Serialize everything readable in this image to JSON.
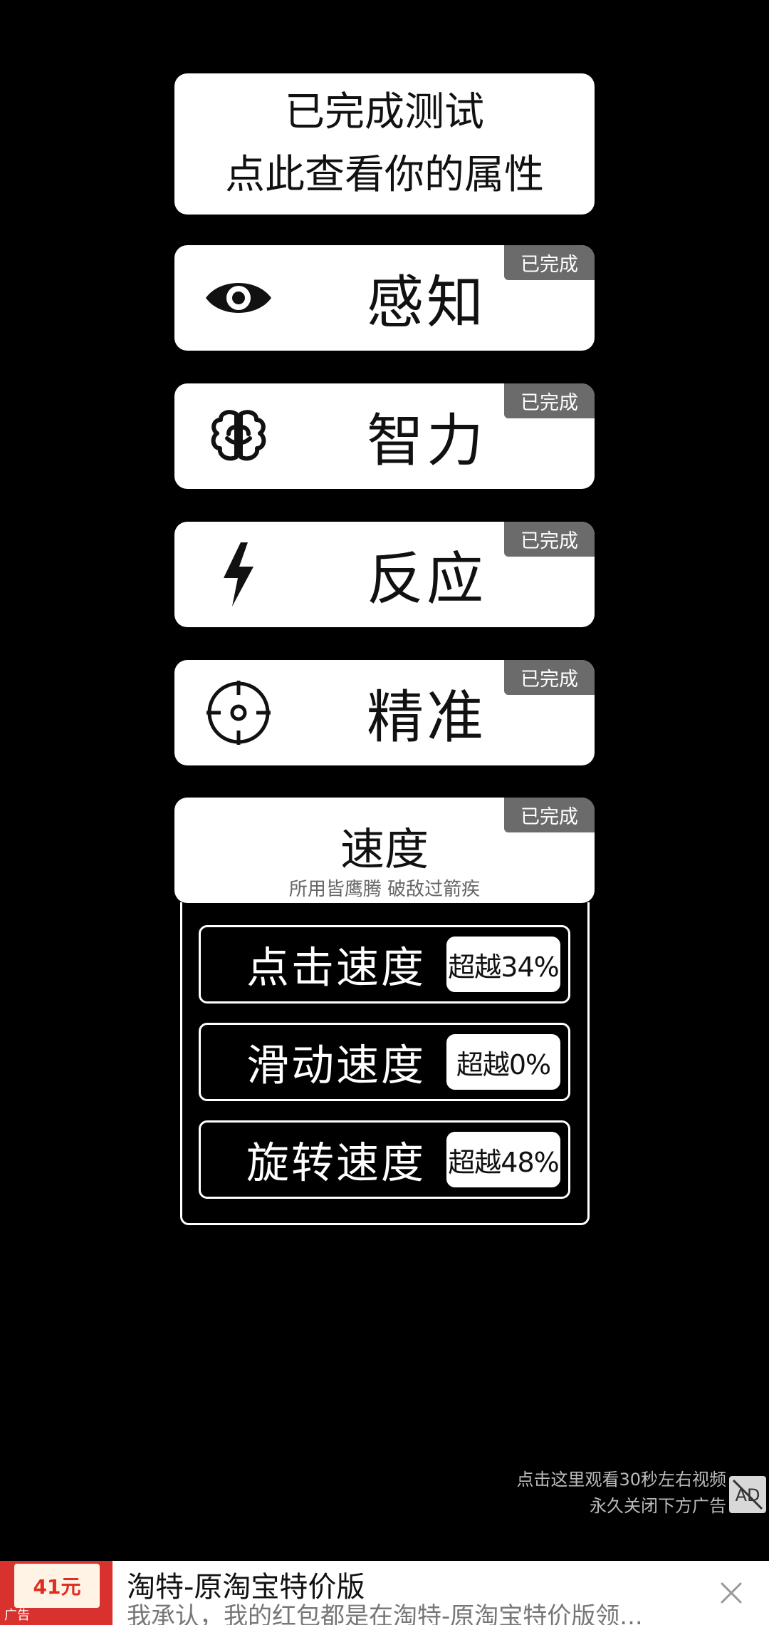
{
  "top_card": {
    "line1": "已完成测试",
    "line2": "点此查看你的属性"
  },
  "categories": [
    {
      "label": "感知",
      "badge": "已完成",
      "icon": "eye-icon"
    },
    {
      "label": "智力",
      "badge": "已完成",
      "icon": "brain-icon"
    },
    {
      "label": "反应",
      "badge": "已完成",
      "icon": "lightning-icon"
    },
    {
      "label": "精准",
      "badge": "已完成",
      "icon": "crosshair-icon"
    }
  ],
  "speed": {
    "title": "速度",
    "subtitle": "所用皆鹰腾 破敌过箭疾",
    "badge": "已完成",
    "metrics": [
      {
        "name": "点击速度",
        "result": "超越34%"
      },
      {
        "name": "滑动速度",
        "result": "超越0%"
      },
      {
        "name": "旋转速度",
        "result": "超越48%"
      }
    ]
  },
  "ad_prompt": {
    "line1": "点击这里观看30秒左右视频",
    "line2": "永久关闭下方广告"
  },
  "banner": {
    "thumb_price": "41元",
    "thumb_tag": "广告",
    "title": "淘特-原淘宝特价版",
    "description": "我承认，我的红包都是在淘特-原淘宝特价版领..."
  }
}
